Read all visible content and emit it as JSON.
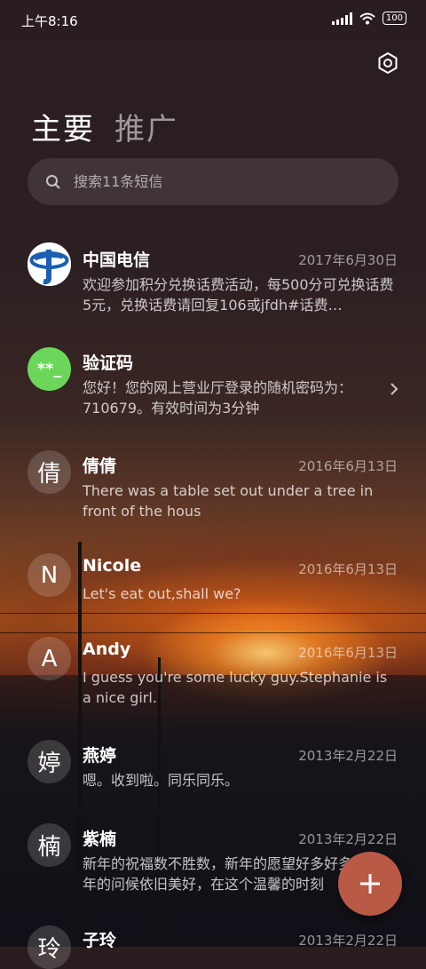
{
  "status_bar": {
    "time": "上午8:16",
    "battery": "100"
  },
  "tabs": {
    "main": "主要",
    "promo": "推广"
  },
  "search": {
    "placeholder": "搜索11条短信"
  },
  "conversations": [
    {
      "avatar_text": "",
      "avatar_type": "china-telecom-logo",
      "name": "中国电信",
      "date": "2017年6月30日",
      "preview": "欢迎参加积分兑换话费活动，每500分可兑换话费5元，兑换话费请回复106或jfdh#话费…"
    },
    {
      "avatar_text": "**_",
      "avatar_type": "verification-code",
      "name": "验证码",
      "date": "",
      "preview": "您好！您的网上营业厅登录的随机密码为：710679。有效时间为3分钟"
    },
    {
      "avatar_text": "倩",
      "name": "倩倩",
      "date": "2016年6月13日",
      "preview": "There was a table set out under a tree in front of the hous"
    },
    {
      "avatar_text": "N",
      "name": "Nicole",
      "date": "2016年6月13日",
      "preview": "Let's eat out,shall we?"
    },
    {
      "avatar_text": "A",
      "name": "Andy",
      "date": "2016年6月13日",
      "preview": "I guess you're some lucky guy.Stephanie is a nice girl."
    },
    {
      "avatar_text": "婷",
      "name": "燕婷",
      "date": "2013年2月22日",
      "preview": "嗯。收到啦。同乐同乐。"
    },
    {
      "avatar_text": "楠",
      "name": "紫楠",
      "date": "2013年2月22日",
      "preview": "新年的祝福数不胜数，新年的愿望好多好多，新年的问候依旧美好，在这个温馨的时刻"
    },
    {
      "avatar_text": "玲",
      "name": "子玲",
      "date": "2013年2月22日",
      "preview": ""
    }
  ],
  "colors": {
    "fab": "#b85a45",
    "verification_avatar": "#6bd65a",
    "telecom_blue": "#1a5fb4"
  }
}
